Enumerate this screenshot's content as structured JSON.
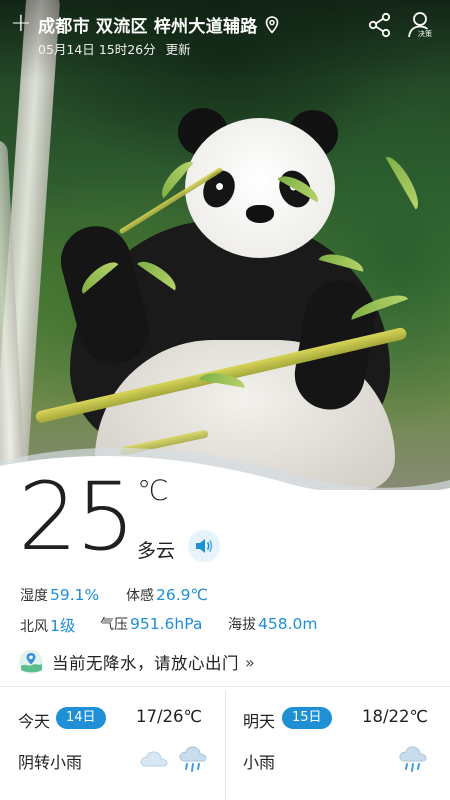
{
  "header": {
    "add_symbol": "+",
    "city": "成都市",
    "district": "双流区",
    "street": "梓州大道辅路",
    "update_date": "05月14日",
    "update_clock": "15时26分",
    "update_suffix": "更新",
    "profile_tag": "决策"
  },
  "current": {
    "temperature": "25",
    "unit": "℃",
    "condition": "多云"
  },
  "details": {
    "humidity_label": "湿度",
    "humidity_value": "59.1%",
    "feels_label": "体感",
    "feels_value": "26.9℃",
    "wind_direction": "北风",
    "wind_level": "1级",
    "pressure_label": "气压",
    "pressure_value": "951.6hPa",
    "altitude_label": "海拔",
    "altitude_value": "458.0m"
  },
  "advice": {
    "text": "当前无降水，请放心出门",
    "arrow": "»"
  },
  "forecast": [
    {
      "day": "今天",
      "date": "14日",
      "range": "17/26℃",
      "condition": "阴转小雨",
      "icons": [
        "cloud-icon",
        "rain-cloud-icon"
      ]
    },
    {
      "day": "明天",
      "date": "15日",
      "range": "18/22℃",
      "condition": "小雨",
      "icons": [
        "rain-cloud-icon"
      ]
    }
  ],
  "colors": {
    "accent": "#1f8fd6",
    "text": "#222222"
  }
}
